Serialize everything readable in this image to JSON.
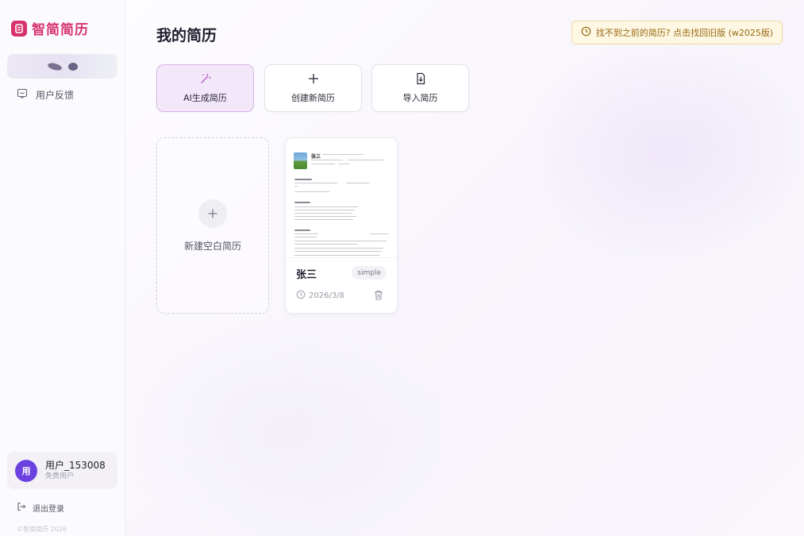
{
  "app": {
    "name": "智简简历"
  },
  "sidebar": {
    "nav": [
      {
        "label": "用户反馈",
        "icon": "feedback-icon"
      }
    ],
    "user": {
      "avatar_initial": "用",
      "name": "用户_153008",
      "plan": "免费用户"
    },
    "logout_label": "退出登录",
    "copyright": "©智简简历 2026"
  },
  "main": {
    "title": "我的简历",
    "old_version_notice": "找不到之前的简历? 点击找回旧版 (w2025版)",
    "actions": [
      {
        "label": "AI生成简历",
        "icon": "magic-wand-icon"
      },
      {
        "label": "创建新简历",
        "icon": "plus-icon"
      },
      {
        "label": "导入简历",
        "icon": "import-file-icon"
      }
    ],
    "new_blank_label": "新建空白简历",
    "resumes": [
      {
        "name": "张三",
        "template": "simple",
        "date": "2026/3/8",
        "thumbnail": {
          "name": "张三"
        }
      }
    ]
  },
  "colors": {
    "brand": "#d6336c",
    "avatar": "#6b42e0",
    "ai_button_bg": "#f3e8f9",
    "notice_bg": "#fdf7e3",
    "notice_text": "#9a6b12"
  }
}
